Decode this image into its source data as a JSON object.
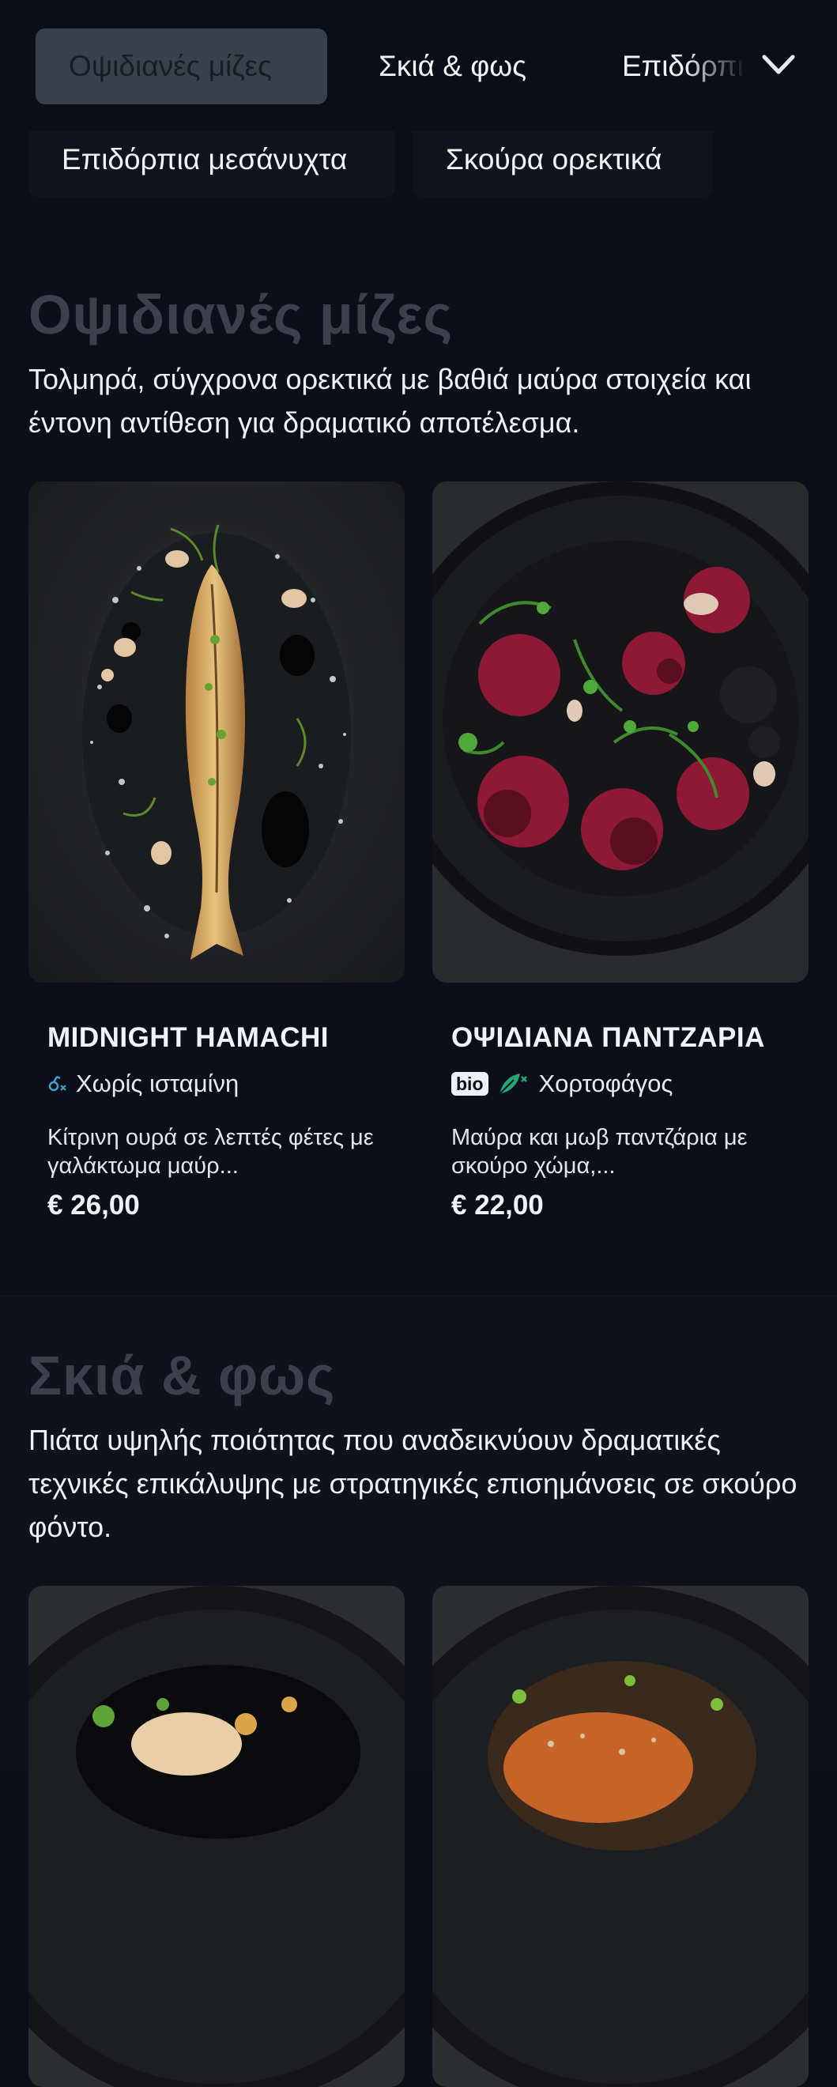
{
  "nav": {
    "tabs": [
      "Οψιδιανές μίζες",
      "Σκιά & φως",
      "Επιδόρπια μεσάνυχτα"
    ],
    "chips": [
      "Επιδόρπια μεσάνυχτα",
      "Σκούρα ορεκτικά"
    ]
  },
  "sections": [
    {
      "title": "Οψιδιανές μίζες",
      "description": "Τολμηρά, σύγχρονα ορεκτικά με βαθιά μαύρα στοιχεία και έντονη αντίθεση για δραματικό αποτέλεσμα.",
      "items": [
        {
          "name": "MIDNIGHT HAMACHI",
          "tag": "Χωρίς ισταμίνη",
          "description": "Κίτρινη ουρά σε λεπτές φέτες με γαλάκτωμα μαύρ...",
          "price": "€ 26,00"
        },
        {
          "name": "ΟΨΙΔΙΑΝΑ ΠΑΝΤΖΑΡΙΑ",
          "badge": "bio",
          "tag": "Χορτοφάγος",
          "description": "Μαύρα και μωβ παντζάρια με σκούρο χώμα,...",
          "price": "€ 22,00"
        }
      ]
    },
    {
      "title": "Σκιά & φως",
      "description": "Πιάτα υψηλής ποιότητας που αναδεικνύουν δραματικές τεχνικές επικάλυψης με στρατηγικές επισημάνσεις σε σκούρο φόντο."
    }
  ],
  "colors": {
    "background": "#0d0f18",
    "active_tab": "#3a3f4c",
    "section_title": "#3d404c",
    "vegetarian_icon": "#1fa873",
    "histamine_icon": "#3aa3d8"
  }
}
